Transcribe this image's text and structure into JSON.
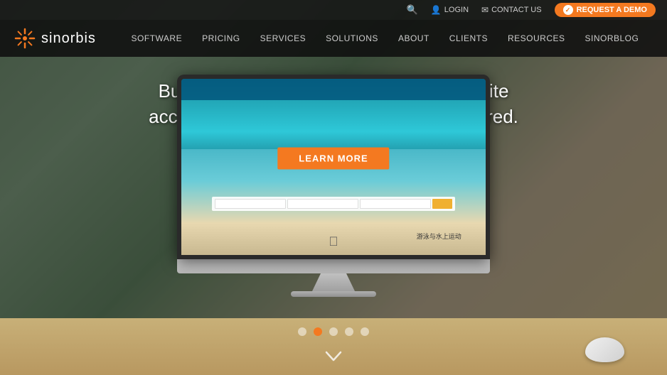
{
  "topbar": {
    "search_label": "Search",
    "login_label": "LOGIN",
    "contact_label": "CONTACT US",
    "demo_label": "REQUEST A DEMO"
  },
  "navbar": {
    "logo_text": "sinorbis",
    "links": [
      {
        "id": "software",
        "label": "SOFTWARE"
      },
      {
        "id": "pricing",
        "label": "PRICING"
      },
      {
        "id": "services",
        "label": "SERVICES"
      },
      {
        "id": "solutions",
        "label": "SOLUTIONS"
      },
      {
        "id": "about",
        "label": "ABOUT"
      },
      {
        "id": "clients",
        "label": "CLIENTS"
      },
      {
        "id": "resources",
        "label": "RESOURCES"
      },
      {
        "id": "sinorblog",
        "label": "SINORBLOG"
      }
    ]
  },
  "hero": {
    "headline_line1": "Build a beautiful, search-optimised website",
    "headline_line2": "accessible from China, no ICP filing required.",
    "learn_more_label": "LEARN MORE"
  },
  "screen": {
    "chinese_text": "游泳与水上运动"
  },
  "slider": {
    "total_dots": 5,
    "active_dot": 1
  },
  "scroll_arrow": "⌄"
}
